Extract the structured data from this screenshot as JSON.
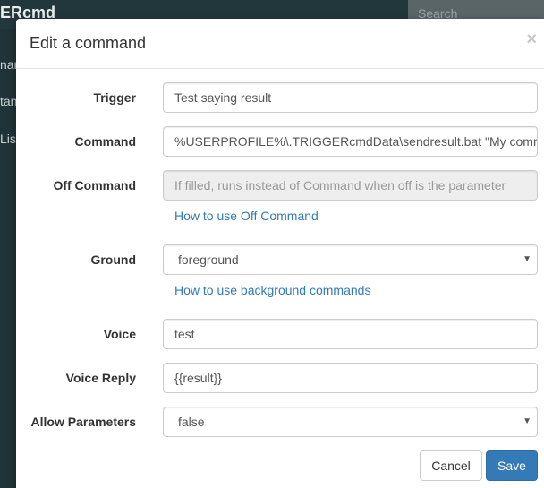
{
  "app": {
    "brand": "ERcmd",
    "search_placeholder": "Search",
    "side_items": [
      "nar",
      "tan",
      "Lis"
    ]
  },
  "modal": {
    "title": "Edit a command",
    "close_label": "×",
    "fields": {
      "trigger": {
        "label": "Trigger",
        "value": "Test saying result"
      },
      "command": {
        "label": "Command",
        "value": "%USERPROFILE%\\.TRIGGERcmdData\\sendresult.bat \"My command result\""
      },
      "off_command": {
        "label": "Off Command",
        "placeholder": "If filled, runs instead of Command when off is the parameter",
        "help_link": "How to use Off Command"
      },
      "ground": {
        "label": "Ground",
        "value": "foreground",
        "help_link": "How to use background commands"
      },
      "voice": {
        "label": "Voice",
        "value": "test"
      },
      "voice_reply": {
        "label": "Voice Reply",
        "value": "{{result}}"
      },
      "allow_parameters": {
        "label": "Allow Parameters",
        "value": "false"
      }
    },
    "buttons": {
      "cancel": "Cancel",
      "save": "Save"
    }
  },
  "colors": {
    "primary": "#337ab7",
    "link": "#337ab7",
    "backdrop": "#1f2f33"
  }
}
